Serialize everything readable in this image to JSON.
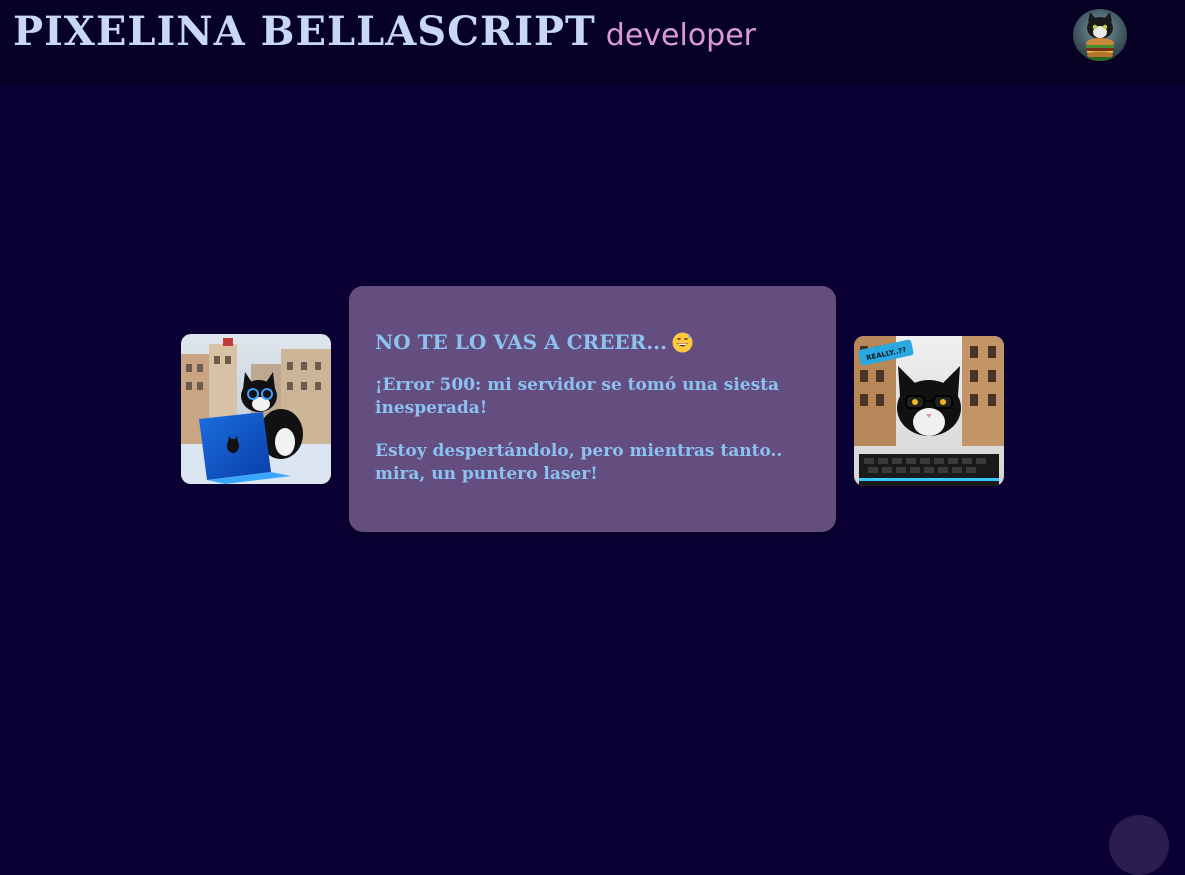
{
  "header": {
    "brand_name": "PIXELINA BELLASCRIPT",
    "brand_role": "developer",
    "avatar_alt": "cat avatar with burger"
  },
  "card": {
    "title": "NO TE LO VAS A CREER...",
    "title_emoji": "grinning-sweat-emoji",
    "paragraph_1": "¡Error 500: mi servidor se tomó una siesta inesperada!",
    "paragraph_2": "Estoy despertándolo, pero mientras tanto.. mira, un puntero laser!"
  },
  "photos": {
    "left": "cat with glasses using laptop",
    "right": "cat with glasses at keyboard",
    "right_sign_text": "REALLY..??"
  },
  "colors": {
    "background": "#0b0033",
    "header": "#070225",
    "card": "#644d7f",
    "card_text": "#8cc2f0",
    "brand_name": "#c8d7f2",
    "brand_role": "#d99bd6"
  }
}
